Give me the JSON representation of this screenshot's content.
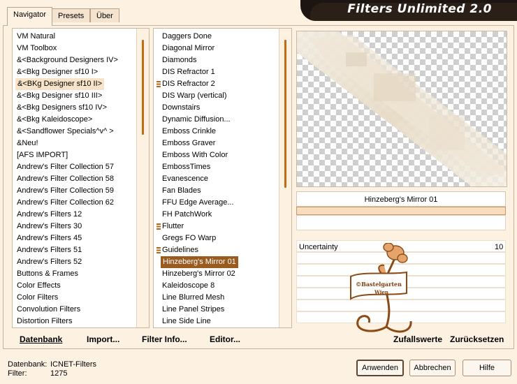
{
  "app": {
    "title": "Filters Unlimited 2.0"
  },
  "tabs": [
    {
      "label": "Navigator",
      "active": true
    },
    {
      "label": "Presets",
      "active": false
    },
    {
      "label": "Über",
      "active": false
    }
  ],
  "categories": {
    "items": [
      "VM Natural",
      "VM Toolbox",
      "&<Background Designers IV>",
      "&<Bkg Designer sf10 I>",
      "&<BKg Designer sf10 II>",
      "&<Bkg Designer sf10 III>",
      "&<Bkg Designers sf10 IV>",
      "&<Bkg Kaleidoscope>",
      "&<Sandflower Specials^v^ >",
      "&Neu!",
      "[AFS IMPORT]",
      "Andrew's Filter Collection 57",
      "Andrew's Filter Collection 58",
      "Andrew's Filter Collection 59",
      "Andrew's Filter Collection 62",
      "Andrew's Filters 12",
      "Andrew's Filters 30",
      "Andrew's Filters 45",
      "Andrew's Filters 51",
      "Andrew's Filters 52",
      "Buttons & Frames",
      "Color Effects",
      "Color Filters",
      "Convolution Filters",
      "Distortion Filters"
    ],
    "highlighted_index": 4,
    "scroll_position": 0.3
  },
  "filters": {
    "items": [
      {
        "label": "Daggers Done",
        "marker": false
      },
      {
        "label": "Diagonal Mirror",
        "marker": false
      },
      {
        "label": "Diamonds",
        "marker": false
      },
      {
        "label": "DIS Refractor 1",
        "marker": false
      },
      {
        "label": "DIS Refractor 2",
        "marker": true
      },
      {
        "label": "DIS Warp (vertical)",
        "marker": false
      },
      {
        "label": "Downstairs",
        "marker": false
      },
      {
        "label": "Dynamic Diffusion...",
        "marker": false
      },
      {
        "label": "Emboss Crinkle",
        "marker": false
      },
      {
        "label": "Emboss Graver",
        "marker": false
      },
      {
        "label": "Emboss With Color",
        "marker": false
      },
      {
        "label": "EmbossTimes",
        "marker": false
      },
      {
        "label": "Evanescence",
        "marker": false
      },
      {
        "label": "Fan Blades",
        "marker": false
      },
      {
        "label": "FFU Edge Average...",
        "marker": false
      },
      {
        "label": "FH PatchWork",
        "marker": false
      },
      {
        "label": "Flutter",
        "marker": true
      },
      {
        "label": "Gregs FO Warp",
        "marker": false
      },
      {
        "label": "Guidelines",
        "marker": true
      },
      {
        "label": "Hinzeberg's Mirror 01",
        "marker": false
      },
      {
        "label": "Hinzeberg's Mirror 02",
        "marker": false
      },
      {
        "label": "Kaleidoscope 8",
        "marker": false
      },
      {
        "label": "Line Blurred Mesh",
        "marker": false
      },
      {
        "label": "Line Panel Stripes",
        "marker": false
      },
      {
        "label": "Line Side Line",
        "marker": false
      }
    ],
    "selected_index": 19,
    "scroll_position": 0.5
  },
  "actions": {
    "database": "Datenbank",
    "import": "Import...",
    "filter_info": "Filter Info...",
    "editor": "Editor...",
    "random": "Zufallswerte",
    "reset": "Zurücksetzen"
  },
  "preview": {
    "filter_name": "Hinzeberg's Mirror 01",
    "params": [
      {
        "label": "Uncertainty",
        "value": "10"
      }
    ],
    "watermark_text": [
      "©Bastelgarten",
      "Wien"
    ]
  },
  "status": {
    "db_label": "Datenbank:",
    "db_value": "ICNET-Filters",
    "filter_label": "Filter:",
    "filter_value": "1275"
  },
  "buttons": {
    "apply": "Anwenden",
    "cancel": "Abbrechen",
    "help": "Hilfe"
  },
  "colors": {
    "accent": "#9a5b1e",
    "background": "#fdf1e2",
    "banner": "#2b2018"
  }
}
